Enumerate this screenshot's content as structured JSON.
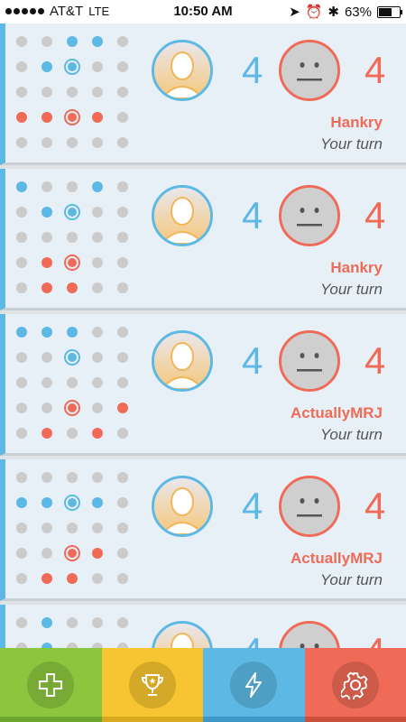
{
  "status_bar": {
    "carrier": "AT&T",
    "network": "LTE",
    "time": "10:50 AM",
    "battery_percent": "63%",
    "battery_level": 0.63
  },
  "colors": {
    "blue": "#5db8e4",
    "red": "#ef6b57",
    "green": "#8cc63f",
    "yellow": "#f7c531",
    "tab_blue": "#5db8e4",
    "tab_red": "#ef6b57"
  },
  "games": [
    {
      "my_score": "4",
      "their_score": "4",
      "opponent": "Hankry",
      "status": "Your turn",
      "board": [
        [
          "g",
          "g",
          "b",
          "b",
          "g"
        ],
        [
          "g",
          "b",
          "B",
          "g",
          "g"
        ],
        [
          "g",
          "g",
          "g",
          "g",
          "g"
        ],
        [
          "r",
          "r",
          "R",
          "r",
          "g"
        ],
        [
          "g",
          "g",
          "g",
          "g",
          "g"
        ]
      ]
    },
    {
      "my_score": "4",
      "their_score": "4",
      "opponent": "Hankry",
      "status": "Your turn",
      "board": [
        [
          "b",
          "g",
          "g",
          "b",
          "g"
        ],
        [
          "g",
          "b",
          "B",
          "g",
          "g"
        ],
        [
          "g",
          "g",
          "g",
          "g",
          "g"
        ],
        [
          "g",
          "r",
          "R",
          "g",
          "g"
        ],
        [
          "g",
          "r",
          "r",
          "g",
          "g"
        ]
      ]
    },
    {
      "my_score": "4",
      "their_score": "4",
      "opponent": "ActuallyMRJ",
      "status": "Your turn",
      "board": [
        [
          "b",
          "b",
          "b",
          "g",
          "g"
        ],
        [
          "g",
          "g",
          "B",
          "g",
          "g"
        ],
        [
          "g",
          "g",
          "g",
          "g",
          "g"
        ],
        [
          "g",
          "g",
          "R",
          "g",
          "r"
        ],
        [
          "g",
          "r",
          "g",
          "r",
          "g"
        ]
      ]
    },
    {
      "my_score": "4",
      "their_score": "4",
      "opponent": "ActuallyMRJ",
      "status": "Your turn",
      "board": [
        [
          "g",
          "g",
          "g",
          "g",
          "g"
        ],
        [
          "b",
          "b",
          "B",
          "b",
          "g"
        ],
        [
          "g",
          "g",
          "g",
          "g",
          "g"
        ],
        [
          "g",
          "g",
          "R",
          "r",
          "g"
        ],
        [
          "g",
          "r",
          "r",
          "g",
          "g"
        ]
      ]
    },
    {
      "my_score": "4",
      "their_score": "4",
      "opponent": "",
      "status": "",
      "board": [
        [
          "g",
          "b",
          "g",
          "g",
          "g"
        ],
        [
          "g",
          "b",
          "g",
          "g",
          "g"
        ],
        [
          "g",
          "g",
          "g",
          "g",
          "g"
        ],
        [
          "g",
          "g",
          "g",
          "g",
          "g"
        ],
        [
          "g",
          "g",
          "g",
          "g",
          "g"
        ]
      ]
    }
  ],
  "tabs": [
    {
      "name": "new-game",
      "icon": "plus-icon",
      "color": "#8cc63f",
      "edge": "#6da62d"
    },
    {
      "name": "trophy",
      "icon": "trophy-icon",
      "color": "#f7c531",
      "edge": "#d9a91f"
    },
    {
      "name": "lightning",
      "icon": "lightning-icon",
      "color": "#5db8e4",
      "edge": "#3f97c7"
    },
    {
      "name": "settings",
      "icon": "gear-icon",
      "color": "#ef6b57",
      "edge": "#cc4f3c"
    }
  ]
}
